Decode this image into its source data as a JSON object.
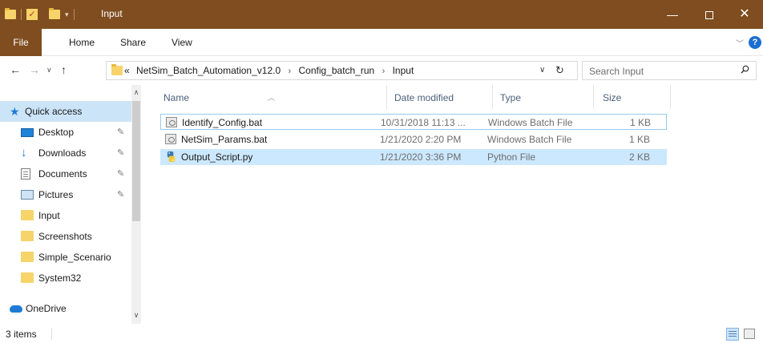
{
  "window": {
    "title": "Input",
    "minimize_glyph": "—",
    "close_glyph": "✕"
  },
  "ribbon": {
    "tabs": [
      "File",
      "Home",
      "Share",
      "View"
    ],
    "help_glyph": "?"
  },
  "address": {
    "overflow": "«",
    "crumbs": [
      "NetSim_Batch_Automation_v12.0",
      "Config_batch_run",
      "Input"
    ],
    "separator": "›",
    "search_placeholder": "Search Input"
  },
  "nav": {
    "items": [
      {
        "label": "Quick access",
        "icon": "star-icon"
      },
      {
        "label": "Desktop",
        "icon": "desktop-icon",
        "pinned": true
      },
      {
        "label": "Downloads",
        "icon": "download-icon",
        "pinned": true
      },
      {
        "label": "Documents",
        "icon": "documents-icon",
        "pinned": true
      },
      {
        "label": "Pictures",
        "icon": "pictures-icon",
        "pinned": true
      },
      {
        "label": "Input",
        "icon": "folder-icon"
      },
      {
        "label": "Screenshots",
        "icon": "folder-icon"
      },
      {
        "label": "Simple_Scenario",
        "icon": "folder-icon"
      },
      {
        "label": "System32",
        "icon": "folder-icon"
      },
      {
        "label": "OneDrive",
        "icon": "onedrive-icon"
      }
    ]
  },
  "columns": {
    "name": "Name",
    "date": "Date modified",
    "type": "Type",
    "size": "Size"
  },
  "files": [
    {
      "name": "Identify_Config.bat",
      "date": "10/31/2018 11:13 ...",
      "type": "Windows Batch File",
      "size": "1 KB",
      "icon": "batch-file-icon"
    },
    {
      "name": "NetSim_Params.bat",
      "date": "1/21/2020 2:20 PM",
      "type": "Windows Batch File",
      "size": "1 KB",
      "icon": "batch-file-icon"
    },
    {
      "name": "Output_Script.py",
      "date": "1/21/2020 3:36 PM",
      "type": "Python File",
      "size": "2 KB",
      "icon": "python-file-icon"
    }
  ],
  "status": {
    "item_count": "3 items"
  },
  "colors": {
    "titlebar": "#7f4d1f",
    "selection": "#cce8ff",
    "nav_selected": "#cce4f7"
  }
}
